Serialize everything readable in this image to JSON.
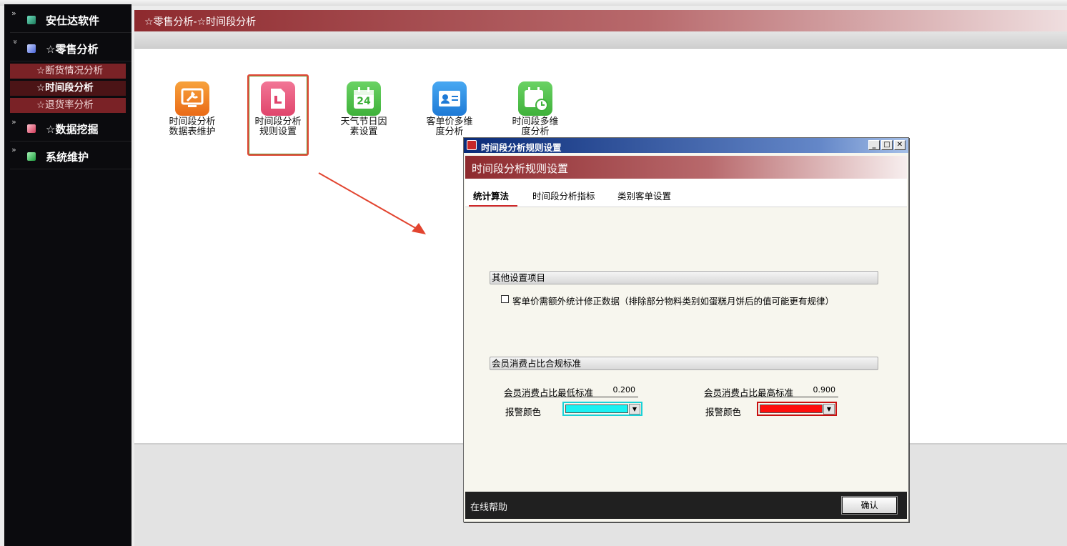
{
  "sidebar": {
    "items": [
      {
        "label": "安仕达软件",
        "chevron": "»",
        "color": "#2aa37a"
      },
      {
        "label": "☆零售分析",
        "chevron": "»",
        "color": "#6f8cff"
      },
      {
        "label": "☆数据挖掘",
        "chevron": "»",
        "color": "#e0607a"
      },
      {
        "label": "系统维护",
        "chevron": "»",
        "color": "#29c95a"
      }
    ],
    "subitems": [
      {
        "label": "☆断货情况分析"
      },
      {
        "label": "☆时间段分析"
      },
      {
        "label": "☆退货率分析"
      }
    ]
  },
  "header": {
    "title": "☆零售分析-☆时间段分析"
  },
  "launcher": {
    "items": [
      {
        "line1": "时间段分析",
        "line2": "数据表维护",
        "icon": "monitor-wrench-icon",
        "color": "#f07a22"
      },
      {
        "line1": "时间段分析",
        "line2": "规则设置",
        "icon": "document-icon",
        "color": "#e8557a"
      },
      {
        "line1": "天气节日因",
        "line2": "素设置",
        "icon": "calendar-24-icon",
        "color": "#52c24d",
        "daynum": "24"
      },
      {
        "line1": "客单价多维",
        "line2": "度分析",
        "icon": "id-card-icon",
        "color": "#2c8de6"
      },
      {
        "line1": "时间段多维",
        "line2": "度分析",
        "icon": "calendar-clock-icon",
        "color": "#52c24d"
      }
    ]
  },
  "dialog": {
    "window_title": "时间段分析规则设置",
    "header": "时间段分析规则设置",
    "tabs": [
      {
        "label": "统计算法"
      },
      {
        "label": "时间段分析指标"
      },
      {
        "label": "类别客单设置"
      }
    ],
    "other_group": "其他设置项目",
    "checkbox_label": "客单价需额外统计修正数据（排除部分物料类别如蛋糕月饼后的值可能更有规律）",
    "checkbox_checked": false,
    "member_group": "会员消费占比合规标准",
    "min_label": "会员消费占比最低标准",
    "min_value": "0.200",
    "max_label": "会员消费占比最高标准",
    "max_value": "0.900",
    "alarm_label_left": "报警颜色",
    "alarm_label_right": "报警颜色",
    "alarm_color_left": "#19f2f2",
    "alarm_color_right": "#ff0d0d",
    "help": "在线帮助",
    "ok": "确认",
    "win_min": "_",
    "win_max": "□",
    "win_close": "✕"
  }
}
